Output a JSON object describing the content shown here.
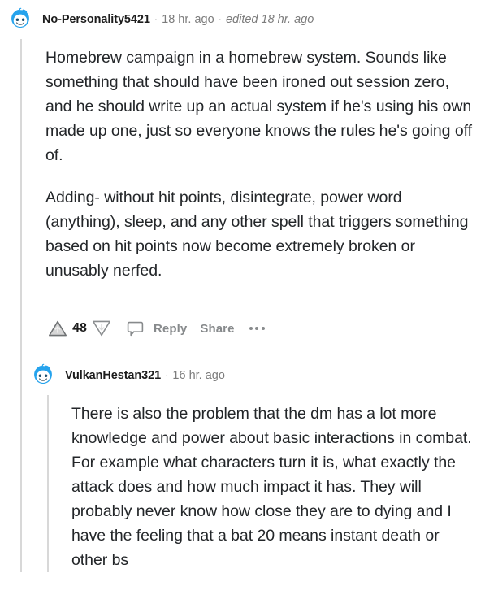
{
  "theme": {
    "background": "#ffffff",
    "body_text_color": "#232629",
    "muted_text_color": "#7c7c7c",
    "action_text_color": "#878a8c",
    "threadline_color": "#d8d8d8",
    "avatar_blue": "#25a3ed",
    "avatar_blue_dark": "#1f8fd6"
  },
  "comments": [
    {
      "avatar_icon": "reddit-snoo-avatar",
      "username": "No-Personality5421",
      "separator": "·",
      "timestamp": "18 hr. ago",
      "edited": "edited 18 hr. ago",
      "paragraphs": [
        "Homebrew campaign in a homebrew system. Sounds like something that should have been ironed out session zero, and he should write up an actual system if he's using his own made up one, just so everyone knows the rules he's going off of.",
        "Adding- without hit points, disintegrate, power word (anything), sleep, and any other spell that triggers something based on hit points now become extremely broken or unusably nerfed."
      ],
      "actions": {
        "upvote_icon": "upvote-arrow-icon",
        "score": "48",
        "downvote_icon": "downvote-arrow-icon",
        "comment_icon": "comment-bubble-icon",
        "reply_label": "Reply",
        "share_label": "Share",
        "more_icon": "more-options-icon"
      }
    },
    {
      "avatar_icon": "reddit-snoo-avatar",
      "username": "VulkanHestan321",
      "separator": "·",
      "timestamp": "16 hr. ago",
      "edited": "",
      "paragraphs": [
        "There is also the problem that the dm has a lot more knowledge and power about basic interactions in combat. For example what characters turn it is, what exactly the attack does and how much impact it has. They will probably never know how close they are to dying and I have the feeling that a bat 20 means instant death or other bs"
      ],
      "actions": null
    }
  ]
}
